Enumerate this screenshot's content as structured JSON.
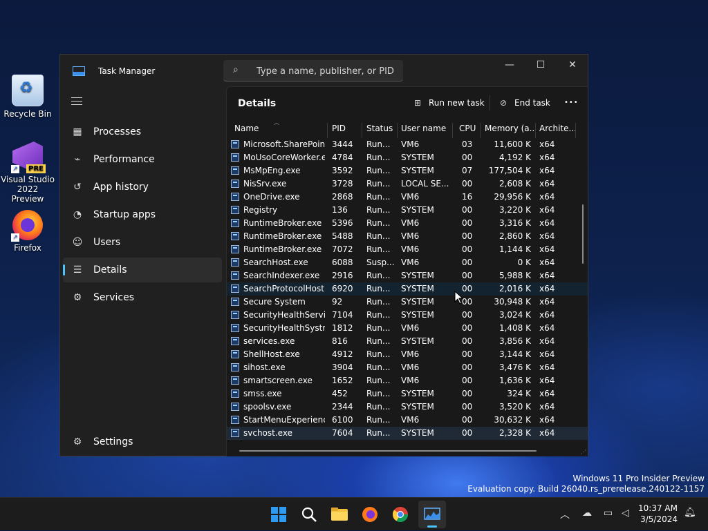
{
  "desktop": {
    "icons": [
      {
        "label": "Recycle Bin"
      },
      {
        "label": "Visual Studio 2022 Preview",
        "badge": "PRE"
      },
      {
        "label": "Firefox"
      }
    ],
    "watermark": {
      "line1": "Windows 11 Pro Insider Preview",
      "line2": "Evaluation copy. Build 26040.rs_prerelease.240122-1157"
    }
  },
  "window": {
    "title": "Task Manager",
    "search_placeholder": "Type a name, publisher, or PID...",
    "controls": {
      "minimize": "—",
      "maximize": "☐",
      "close": "✕"
    }
  },
  "sidebar": {
    "items": [
      {
        "label": "Processes",
        "icon": "processes-icon"
      },
      {
        "label": "Performance",
        "icon": "performance-icon"
      },
      {
        "label": "App history",
        "icon": "app-history-icon"
      },
      {
        "label": "Startup apps",
        "icon": "startup-apps-icon"
      },
      {
        "label": "Users",
        "icon": "users-icon"
      },
      {
        "label": "Details",
        "icon": "details-icon",
        "active": true
      },
      {
        "label": "Services",
        "icon": "services-icon"
      }
    ],
    "settings_label": "Settings"
  },
  "details": {
    "title": "Details",
    "run_new_task": "Run new task",
    "end_task": "End task",
    "more": "•••",
    "columns": [
      "Name",
      "PID",
      "Status",
      "User name",
      "CPU",
      "Memory (a...",
      "Archite..."
    ],
    "rows": [
      {
        "name": "Microsoft.SharePoin...",
        "pid": "3444",
        "status": "Run...",
        "user": "VM6",
        "cpu": "03",
        "mem": "11,600 K",
        "arch": "x64"
      },
      {
        "name": "MoUsoCoreWorker.e...",
        "pid": "4784",
        "status": "Run...",
        "user": "SYSTEM",
        "cpu": "00",
        "mem": "4,192 K",
        "arch": "x64"
      },
      {
        "name": "MsMpEng.exe",
        "pid": "3592",
        "status": "Run...",
        "user": "SYSTEM",
        "cpu": "07",
        "mem": "177,504 K",
        "arch": "x64"
      },
      {
        "name": "NisSrv.exe",
        "pid": "3728",
        "status": "Run...",
        "user": "LOCAL SE...",
        "cpu": "00",
        "mem": "2,608 K",
        "arch": "x64"
      },
      {
        "name": "OneDrive.exe",
        "pid": "2868",
        "status": "Run...",
        "user": "VM6",
        "cpu": "16",
        "mem": "29,956 K",
        "arch": "x64"
      },
      {
        "name": "Registry",
        "pid": "136",
        "status": "Run...",
        "user": "SYSTEM",
        "cpu": "00",
        "mem": "3,220 K",
        "arch": "x64"
      },
      {
        "name": "RuntimeBroker.exe",
        "pid": "5396",
        "status": "Run...",
        "user": "VM6",
        "cpu": "00",
        "mem": "3,316 K",
        "arch": "x64"
      },
      {
        "name": "RuntimeBroker.exe",
        "pid": "5488",
        "status": "Run...",
        "user": "VM6",
        "cpu": "00",
        "mem": "2,860 K",
        "arch": "x64"
      },
      {
        "name": "RuntimeBroker.exe",
        "pid": "7072",
        "status": "Run...",
        "user": "VM6",
        "cpu": "00",
        "mem": "1,144 K",
        "arch": "x64"
      },
      {
        "name": "SearchHost.exe",
        "pid": "6088",
        "status": "Susp...",
        "user": "VM6",
        "cpu": "00",
        "mem": "0 K",
        "arch": "x64"
      },
      {
        "name": "SearchIndexer.exe",
        "pid": "2916",
        "status": "Run...",
        "user": "SYSTEM",
        "cpu": "00",
        "mem": "5,988 K",
        "arch": "x64"
      },
      {
        "name": "SearchProtocolHost....",
        "pid": "6920",
        "status": "Run...",
        "user": "SYSTEM",
        "cpu": "00",
        "mem": "2,016 K",
        "arch": "x64"
      },
      {
        "name": "Secure System",
        "pid": "92",
        "status": "Run...",
        "user": "SYSTEM",
        "cpu": "00",
        "mem": "30,948 K",
        "arch": "x64"
      },
      {
        "name": "SecurityHealthServic...",
        "pid": "7104",
        "status": "Run...",
        "user": "SYSTEM",
        "cpu": "00",
        "mem": "3,024 K",
        "arch": "x64"
      },
      {
        "name": "SecurityHealthSystra...",
        "pid": "1812",
        "status": "Run...",
        "user": "VM6",
        "cpu": "00",
        "mem": "1,408 K",
        "arch": "x64"
      },
      {
        "name": "services.exe",
        "pid": "816",
        "status": "Run...",
        "user": "SYSTEM",
        "cpu": "00",
        "mem": "3,856 K",
        "arch": "x64"
      },
      {
        "name": "ShellHost.exe",
        "pid": "4912",
        "status": "Run...",
        "user": "VM6",
        "cpu": "00",
        "mem": "3,144 K",
        "arch": "x64"
      },
      {
        "name": "sihost.exe",
        "pid": "3904",
        "status": "Run...",
        "user": "VM6",
        "cpu": "00",
        "mem": "3,476 K",
        "arch": "x64"
      },
      {
        "name": "smartscreen.exe",
        "pid": "1652",
        "status": "Run...",
        "user": "VM6",
        "cpu": "00",
        "mem": "1,636 K",
        "arch": "x64"
      },
      {
        "name": "smss.exe",
        "pid": "452",
        "status": "Run...",
        "user": "SYSTEM",
        "cpu": "00",
        "mem": "324 K",
        "arch": "x64"
      },
      {
        "name": "spoolsv.exe",
        "pid": "2344",
        "status": "Run...",
        "user": "SYSTEM",
        "cpu": "00",
        "mem": "3,520 K",
        "arch": "x64"
      },
      {
        "name": "StartMenuExperienc...",
        "pid": "6100",
        "status": "Run...",
        "user": "VM6",
        "cpu": "00",
        "mem": "30,632 K",
        "arch": "x64"
      },
      {
        "name": "svchost.exe",
        "pid": "7604",
        "status": "Run...",
        "user": "SYSTEM",
        "cpu": "00",
        "mem": "2,328 K",
        "arch": "x64",
        "selected": true
      }
    ]
  },
  "taskbar": {
    "apps": [
      "start-icon",
      "search-icon",
      "file-explorer-icon",
      "firefox-icon",
      "chrome-icon",
      "task-manager-icon"
    ],
    "tray": [
      "chevron-up-icon",
      "onedrive-icon",
      "network-icon",
      "volume-icon"
    ],
    "time": "10:37 AM",
    "date": "3/5/2024"
  },
  "colors": {
    "accent": "#4cc2ff",
    "window_bg": "#202020",
    "content_bg": "#191919",
    "selected_row": "#1f2a36"
  }
}
